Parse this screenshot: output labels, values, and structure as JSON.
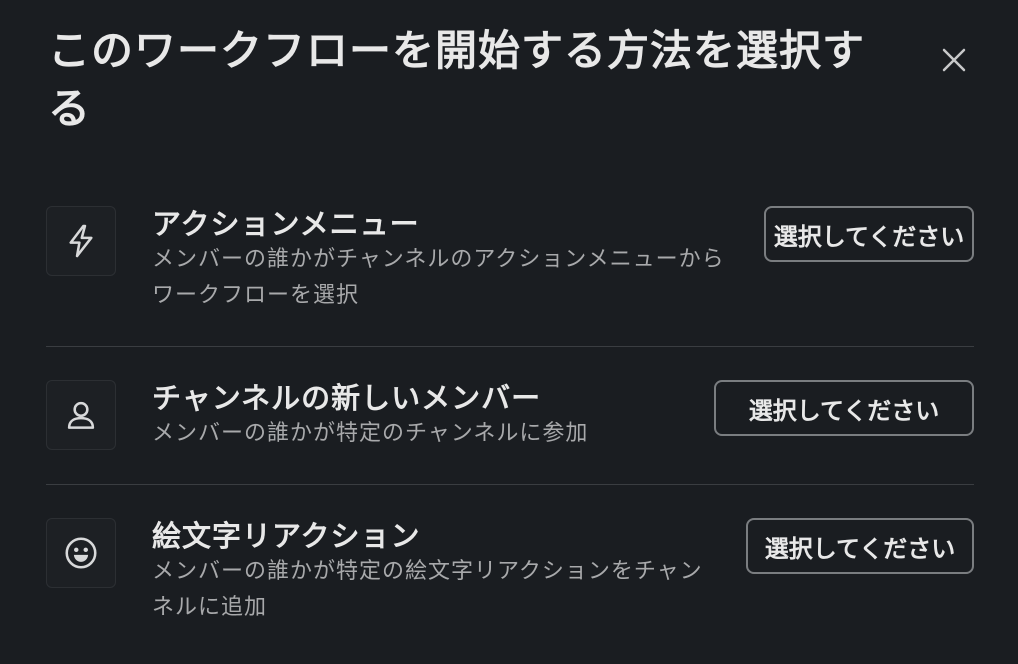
{
  "dialog": {
    "title": "このワークフローを開始する方法を選択する",
    "close_icon": "close-icon"
  },
  "options": [
    {
      "icon": "lightning-icon",
      "title": "アクションメニュー",
      "description": "メンバーの誰かがチャンネルのアクションメニューからワークフローを選択",
      "button_label": "選択してください"
    },
    {
      "icon": "person-icon",
      "title": "チャンネルの新しいメンバー",
      "description": "メンバーの誰かが特定のチャンネルに参加",
      "button_label": "選択してください"
    },
    {
      "icon": "smiley-icon",
      "title": "絵文字リアクション",
      "description": "メンバーの誰かが特定の絵文字リアクションをチャンネルに追加",
      "button_label": "選択してください"
    }
  ],
  "colors": {
    "background": "#1a1d21",
    "text_primary": "#e8e8e8",
    "text_secondary": "#a8a9ab",
    "border": "#7a7d80"
  }
}
